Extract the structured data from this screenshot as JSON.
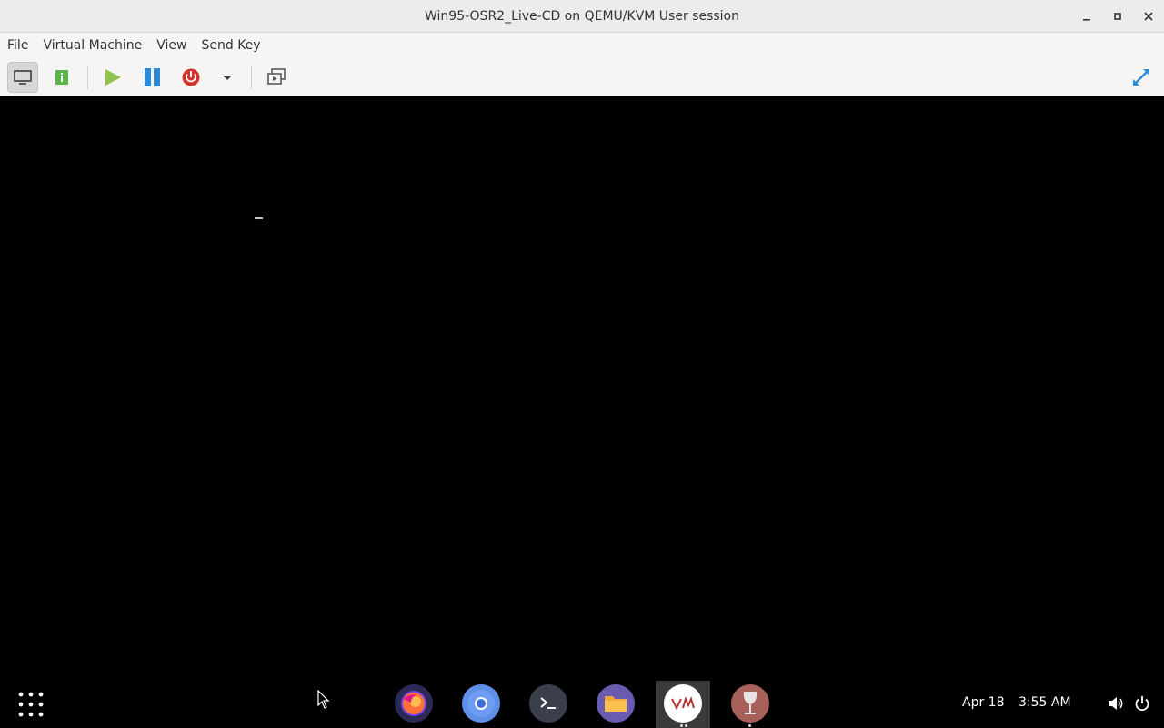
{
  "window": {
    "title": "Win95-OSR2_Live-CD on QEMU/KVM User session",
    "controls": {
      "minimize": "minimize-icon",
      "maximize": "maximize-icon",
      "close": "close-icon"
    }
  },
  "menubar": {
    "items": [
      {
        "label": "File"
      },
      {
        "label": "Virtual Machine"
      },
      {
        "label": "View"
      },
      {
        "label": "Send Key"
      }
    ]
  },
  "toolbar": {
    "buttons": [
      {
        "name": "console-view",
        "icon": "monitor-icon",
        "active": true
      },
      {
        "name": "details-view",
        "icon": "info-icon",
        "active": false
      },
      {
        "name": "run",
        "icon": "play-icon",
        "active": false
      },
      {
        "name": "pause",
        "icon": "pause-icon",
        "active": false
      },
      {
        "name": "shutdown",
        "icon": "power-icon",
        "active": false
      },
      {
        "name": "shutdown-menu",
        "icon": "chevron-down-icon",
        "active": false
      },
      {
        "name": "snapshots",
        "icon": "snapshot-icon",
        "active": false
      },
      {
        "name": "fullscreen",
        "icon": "fullscreen-icon",
        "active": false
      }
    ],
    "colors": {
      "play": "#8fc34a",
      "pause": "#2d8bd6",
      "power": "#d0342c",
      "info": "#58b548"
    }
  },
  "vm_display": {
    "background": "#000000",
    "text_cursor": "_"
  },
  "dock": {
    "apps": [
      {
        "name": "firefox",
        "icon": "firefox-icon",
        "running": false
      },
      {
        "name": "chromium",
        "icon": "chromium-icon",
        "running": false
      },
      {
        "name": "terminal",
        "icon": "terminal-icon",
        "running": false
      },
      {
        "name": "files",
        "icon": "folder-icon",
        "running": false
      },
      {
        "name": "virt-manager",
        "icon": "virt-manager-icon",
        "running": true
      },
      {
        "name": "wine",
        "icon": "wine-glass-icon",
        "running": true
      }
    ],
    "date": "Apr 18",
    "time": "3:55 AM",
    "tray": [
      "volume-icon",
      "power-icon"
    ]
  }
}
